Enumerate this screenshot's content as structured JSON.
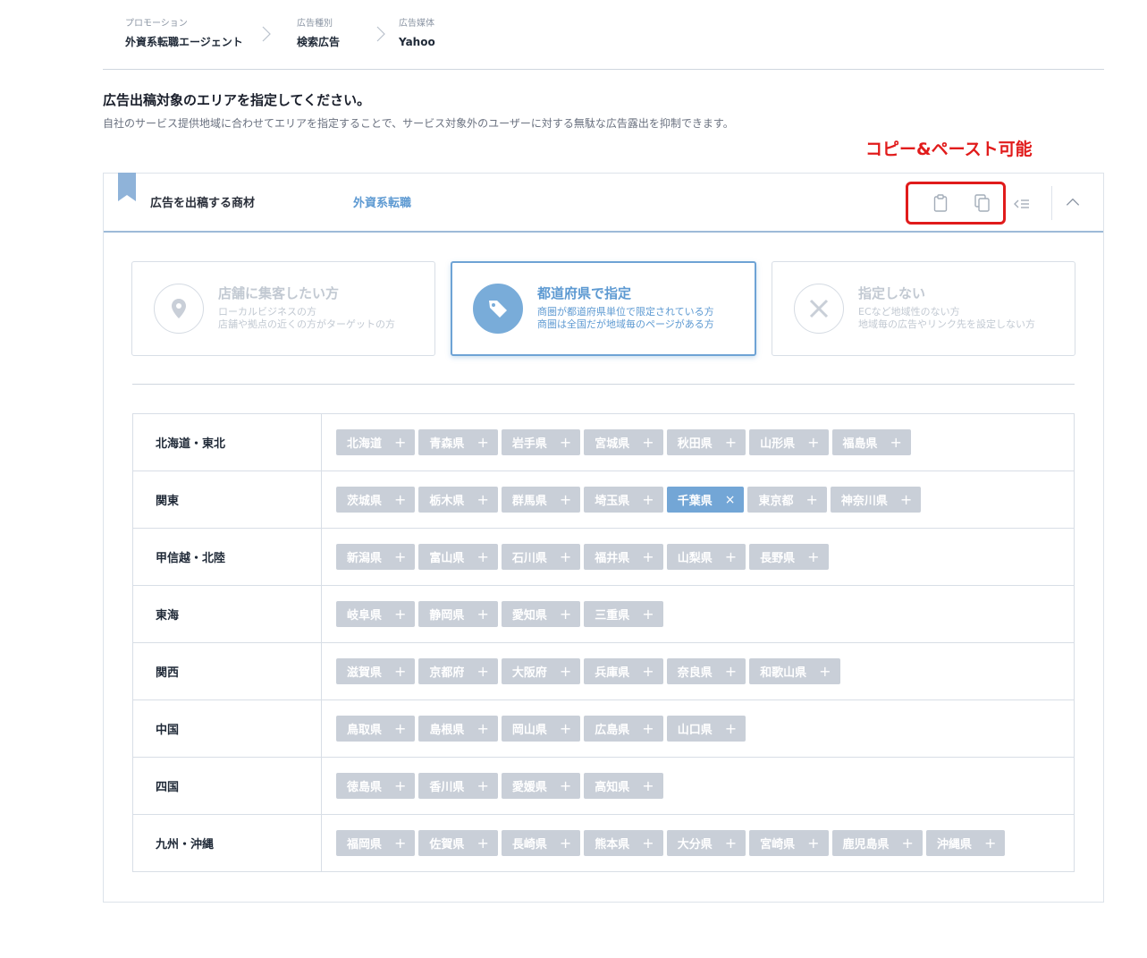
{
  "breadcrumb": [
    {
      "label": "プロモーション",
      "value": "外資系転職エージェント"
    },
    {
      "label": "広告種別",
      "value": "検索広告"
    },
    {
      "label": "広告媒体",
      "value": "Yahoo"
    }
  ],
  "heading": "広告出稿対象のエリアを指定してください。",
  "subheading": "自社のサービス提供地域に合わせてエリアを指定することで、サービス対象外のユーザーに対する無駄な広告露出を抑制できます。",
  "annotation": "コピー&ペースト可能",
  "panel": {
    "label": "広告を出稿する商材",
    "value": "外資系転職"
  },
  "icons": {
    "bookmark": "bookmark-icon",
    "paste": "clipboard-paste-icon",
    "copy": "copy-icon",
    "list": "list-icon",
    "collapse": "chevron-up-icon"
  },
  "options": [
    {
      "title": "店舗に集客したい方",
      "line1": "ローカルビジネスの方",
      "line2": "店舗や拠点の近くの方がターゲットの方",
      "icon": "map-pin-icon",
      "active": false
    },
    {
      "title": "都道府県で指定",
      "line1": "商圏が都道府県単位で限定されている方",
      "line2": "商圏は全国だが地域毎のページがある方",
      "icon": "tag-icon",
      "active": true
    },
    {
      "title": "指定しない",
      "line1": "ECなど地域性のない方",
      "line2": "地域毎の広告やリンク先を設定しない方",
      "icon": "close-icon",
      "active": false
    }
  ],
  "regions": [
    {
      "name": "北海道・東北",
      "prefectures": [
        "北海道",
        "青森県",
        "岩手県",
        "宮城県",
        "秋田県",
        "山形県",
        "福島県"
      ]
    },
    {
      "name": "関東",
      "prefectures": [
        "茨城県",
        "栃木県",
        "群馬県",
        "埼玉県",
        "千葉県",
        "東京都",
        "神奈川県"
      ]
    },
    {
      "name": "甲信越・北陸",
      "prefectures": [
        "新潟県",
        "富山県",
        "石川県",
        "福井県",
        "山梨県",
        "長野県"
      ]
    },
    {
      "name": "東海",
      "prefectures": [
        "岐阜県",
        "静岡県",
        "愛知県",
        "三重県"
      ]
    },
    {
      "name": "関西",
      "prefectures": [
        "滋賀県",
        "京都府",
        "大阪府",
        "兵庫県",
        "奈良県",
        "和歌山県"
      ]
    },
    {
      "name": "中国",
      "prefectures": [
        "鳥取県",
        "島根県",
        "岡山県",
        "広島県",
        "山口県"
      ]
    },
    {
      "name": "四国",
      "prefectures": [
        "徳島県",
        "香川県",
        "愛媛県",
        "高知県"
      ]
    },
    {
      "name": "九州・沖縄",
      "prefectures": [
        "福岡県",
        "佐賀県",
        "長崎県",
        "熊本県",
        "大分県",
        "宮崎県",
        "鹿児島県",
        "沖縄県"
      ]
    }
  ],
  "selected_prefectures": [
    "千葉県"
  ],
  "colors": {
    "accent": "#5e9ad2",
    "selected_tag": "#73a6d6",
    "unselected_tag": "#c9cfd8",
    "annotation": "#e11b1b"
  }
}
